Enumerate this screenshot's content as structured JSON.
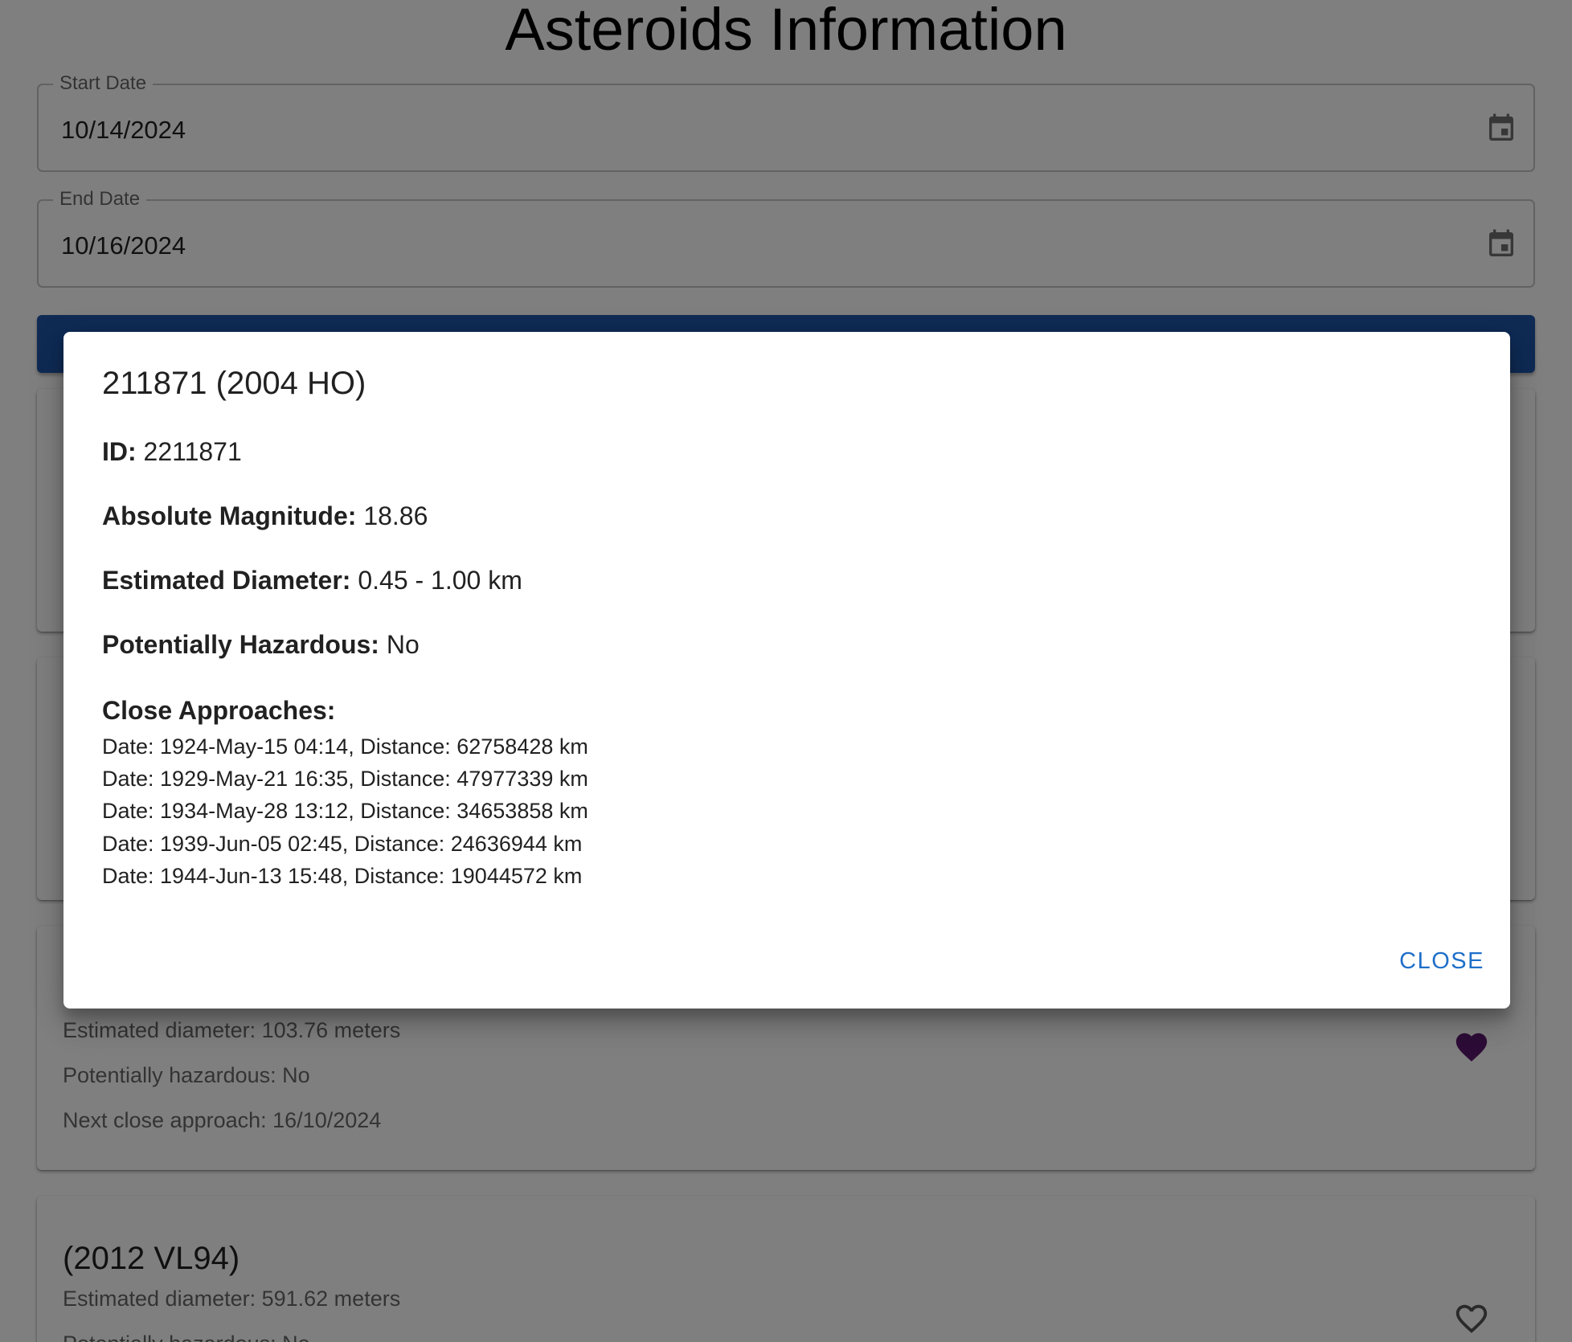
{
  "page": {
    "title": "Asteroids Information"
  },
  "form": {
    "start_date": {
      "label": "Start Date",
      "value": "10/14/2024"
    },
    "end_date": {
      "label": "End Date",
      "value": "10/16/2024"
    },
    "search_button_label": ""
  },
  "cards": [
    {
      "title": "",
      "diameter": "",
      "hazardous": "",
      "next_approach": "",
      "favorite": false
    },
    {
      "title": "",
      "diameter": "",
      "hazardous": "",
      "next_approach": "",
      "favorite": false
    },
    {
      "title": "",
      "diameter": "Estimated diameter: 103.76 meters",
      "hazardous": "Potentially hazardous: No",
      "next_approach": "Next close approach: 16/10/2024",
      "favorite": true
    },
    {
      "title": "(2012 VL94)",
      "diameter": "Estimated diameter: 591.62 meters",
      "hazardous": "Potentially hazardous: No",
      "next_approach": "",
      "favorite": false
    }
  ],
  "dialog": {
    "title": "211871 (2004 HO)",
    "id_label": "ID:",
    "id_value": "2211871",
    "magnitude_label": "Absolute Magnitude:",
    "magnitude_value": "18.86",
    "diameter_label": "Estimated Diameter:",
    "diameter_value": "0.45 - 1.00 km",
    "hazardous_label": "Potentially Hazardous:",
    "hazardous_value": "No",
    "approaches_heading": "Close Approaches:",
    "approaches": [
      "Date: 1924-May-15 04:14, Distance: 62758428 km",
      "Date: 1929-May-21 16:35, Distance: 47977339 km",
      "Date: 1934-May-28 13:12, Distance: 34653858 km",
      "Date: 1939-Jun-05 02:45, Distance: 24636944 km",
      "Date: 1944-Jun-13 15:48, Distance: 19044572 km"
    ],
    "close_label": "CLOSE"
  },
  "colors": {
    "primary_button": "#1f57a8",
    "favorite_heart": "#5a1a6e",
    "close_text": "#1f6fc9",
    "overlay": "rgba(0,0,0,0.5)"
  },
  "icons": {
    "date_picker": "calendar-icon",
    "favorite_filled": "heart-filled-icon",
    "favorite_outline": "heart-outline-icon"
  }
}
